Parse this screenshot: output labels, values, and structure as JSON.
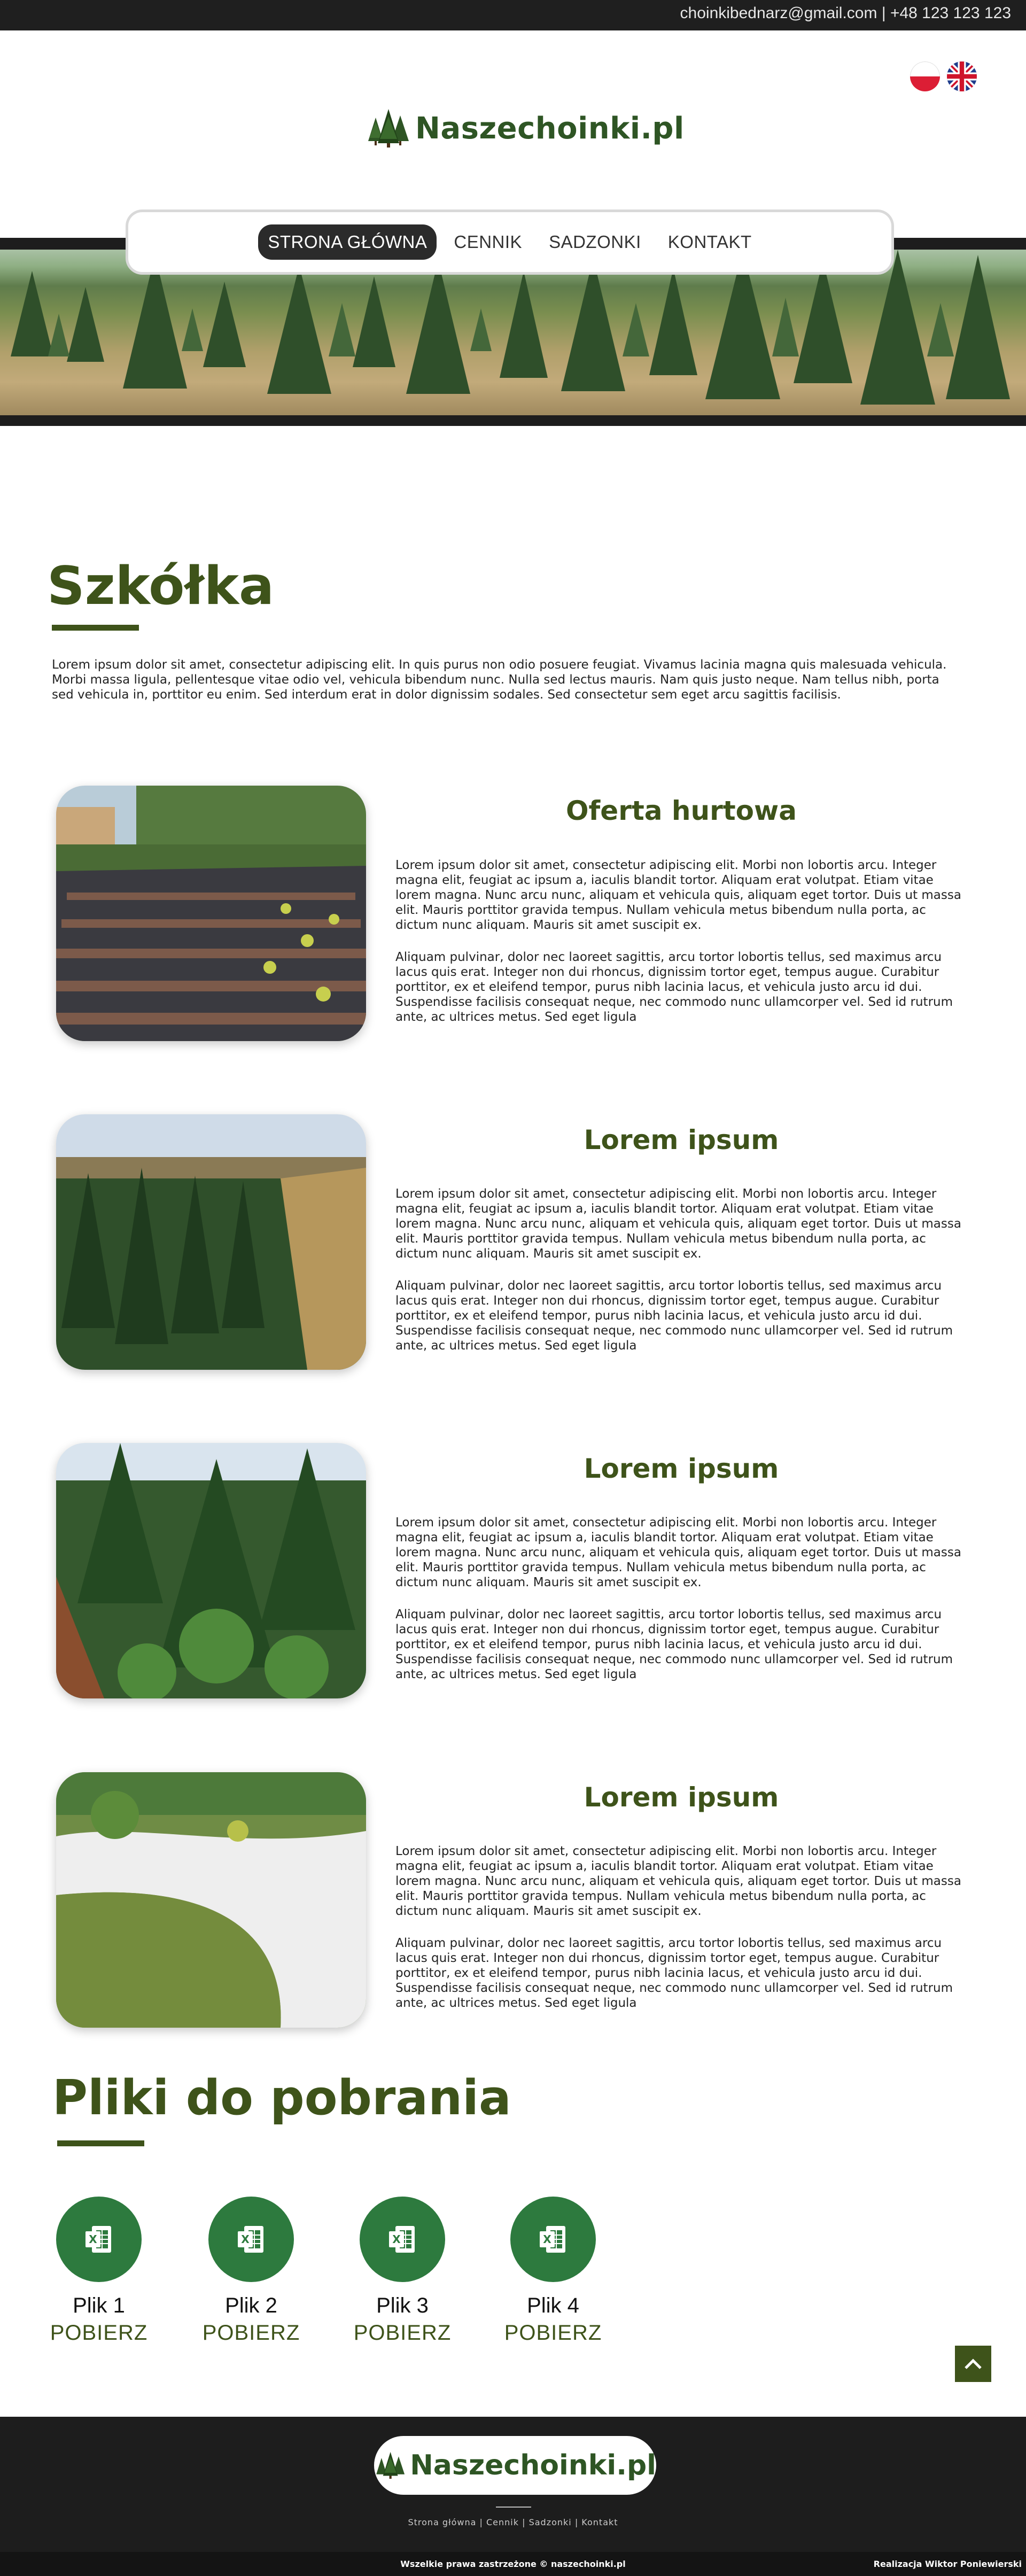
{
  "topbar": {
    "contact": "choinkibednarz@gmail.com | +48 123 123 123"
  },
  "languages": [
    {
      "name": "polish-flag-icon"
    },
    {
      "name": "uk-flag-icon"
    }
  ],
  "brand": {
    "name": "Naszechoinki.pl",
    "color": "#2e5524"
  },
  "nav": {
    "items": [
      "STRONA GŁÓWNA",
      "CENNIK",
      "SADZONKI",
      "KONTAKT"
    ],
    "active": "STRONA GŁÓWNA"
  },
  "colors": {
    "accent": "#3e531a",
    "excel": "#2d7a3e",
    "dark": "#1d1d1d"
  },
  "szkolka": {
    "title": "Szkółka",
    "text": "Lorem ipsum dolor sit amet, consectetur adipiscing elit. In quis purus non odio posuere feugiat. Vivamus lacinia magna quis malesuada vehicula. Morbi massa ligula, pellentesque vitae odio vel, vehicula bibendum nunc. Nulla sed lectus mauris. Nam quis justo neque. Nam tellus nibh, porta sed vehicula in, porttitor eu enim. Sed interdum erat in dolor dignissim sodales. Sed consectetur sem eget arcu sagittis facilisis."
  },
  "cards": [
    {
      "title": "Oferta hurtowa",
      "p1": "Lorem ipsum dolor sit amet, consectetur adipiscing elit. Morbi non lobortis arcu. Integer magna elit, feugiat ac ipsum a, iaculis blandit tortor. Aliquam erat volutpat. Etiam vitae lorem magna. Nunc arcu nunc, aliquam et vehicula quis, aliquam eget tortor. Duis ut massa elit. Mauris porttitor gravida tempus. Nullam vehicula metus bibendum nulla porta, ac dictum nunc aliquam. Mauris sit amet suscipit ex.",
      "p2": "Aliquam pulvinar, dolor nec laoreet sagittis, arcu tortor lobortis tellus, sed maximus arcu lacus quis erat. Integer non dui rhoncus, dignissim tortor eget, tempus augue. Curabitur porttitor, ex et eleifend tempor, purus nibh lacinia lacus, et vehicula justo arcu id dui. Suspendisse facilisis consequat neque, nec commodo nunc ullamcorper vel. Sed id rutrum ante, ac ultrices metus. Sed eget ligula"
    },
    {
      "title": "Lorem ipsum",
      "p1": "Lorem ipsum dolor sit amet, consectetur adipiscing elit. Morbi non lobortis arcu. Integer magna elit, feugiat ac ipsum a, iaculis blandit tortor. Aliquam erat volutpat. Etiam vitae lorem magna. Nunc arcu nunc, aliquam et vehicula quis, aliquam eget tortor. Duis ut massa elit. Mauris porttitor gravida tempus. Nullam vehicula metus bibendum nulla porta, ac dictum nunc aliquam. Mauris sit amet suscipit ex.",
      "p2": "Aliquam pulvinar, dolor nec laoreet sagittis, arcu tortor lobortis tellus, sed maximus arcu lacus quis erat. Integer non dui rhoncus, dignissim tortor eget, tempus augue. Curabitur porttitor, ex et eleifend tempor, purus nibh lacinia lacus, et vehicula justo arcu id dui. Suspendisse facilisis consequat neque, nec commodo nunc ullamcorper vel. Sed id rutrum ante, ac ultrices metus. Sed eget ligula"
    },
    {
      "title": "Lorem ipsum",
      "p1": "Lorem ipsum dolor sit amet, consectetur adipiscing elit. Morbi non lobortis arcu. Integer magna elit, feugiat ac ipsum a, iaculis blandit tortor. Aliquam erat volutpat. Etiam vitae lorem magna. Nunc arcu nunc, aliquam et vehicula quis, aliquam eget tortor. Duis ut massa elit. Mauris porttitor gravida tempus. Nullam vehicula metus bibendum nulla porta, ac dictum nunc aliquam. Mauris sit amet suscipit ex.",
      "p2": "Aliquam pulvinar, dolor nec laoreet sagittis, arcu tortor lobortis tellus, sed maximus arcu lacus quis erat. Integer non dui rhoncus, dignissim tortor eget, tempus augue. Curabitur porttitor, ex et eleifend tempor, purus nibh lacinia lacus, et vehicula justo arcu id dui. Suspendisse facilisis consequat neque, nec commodo nunc ullamcorper vel. Sed id rutrum ante, ac ultrices metus. Sed eget ligula"
    },
    {
      "title": "Lorem ipsum",
      "p1": "Lorem ipsum dolor sit amet, consectetur adipiscing elit. Morbi non lobortis arcu. Integer magna elit, feugiat ac ipsum a, iaculis blandit tortor. Aliquam erat volutpat. Etiam vitae lorem magna. Nunc arcu nunc, aliquam et vehicula quis, aliquam eget tortor. Duis ut massa elit. Mauris porttitor gravida tempus. Nullam vehicula metus bibendum nulla porta, ac dictum nunc aliquam. Mauris sit amet suscipit ex.",
      "p2": "Aliquam pulvinar, dolor nec laoreet sagittis, arcu tortor lobortis tellus, sed maximus arcu lacus quis erat. Integer non dui rhoncus, dignissim tortor eget, tempus augue. Curabitur porttitor, ex et eleifend tempor, purus nibh lacinia lacus, et vehicula justo arcu id dui. Suspendisse facilisis consequat neque, nec commodo nunc ullamcorper vel. Sed id rutrum ante, ac ultrices metus. Sed eget ligula"
    }
  ],
  "downloads": {
    "title": "Pliki do pobrania",
    "files": [
      {
        "name": "Plik 1",
        "action": "POBIERZ",
        "icon": "excel-icon"
      },
      {
        "name": "Plik 2",
        "action": "POBIERZ",
        "icon": "excel-icon"
      },
      {
        "name": "Plik 3",
        "action": "POBIERZ",
        "icon": "excel-icon"
      },
      {
        "name": "Plik 4",
        "action": "POBIERZ",
        "icon": "excel-icon"
      }
    ]
  },
  "footer": {
    "links": [
      "Strona główna",
      "Cennik",
      "Sadzonki",
      "Kontakt"
    ],
    "separator": " | ",
    "copyright": "Wszelkie prawa zastrzeżone © naszechoinki.pl",
    "credit": "Realizacja Wiktor Poniewierski"
  }
}
